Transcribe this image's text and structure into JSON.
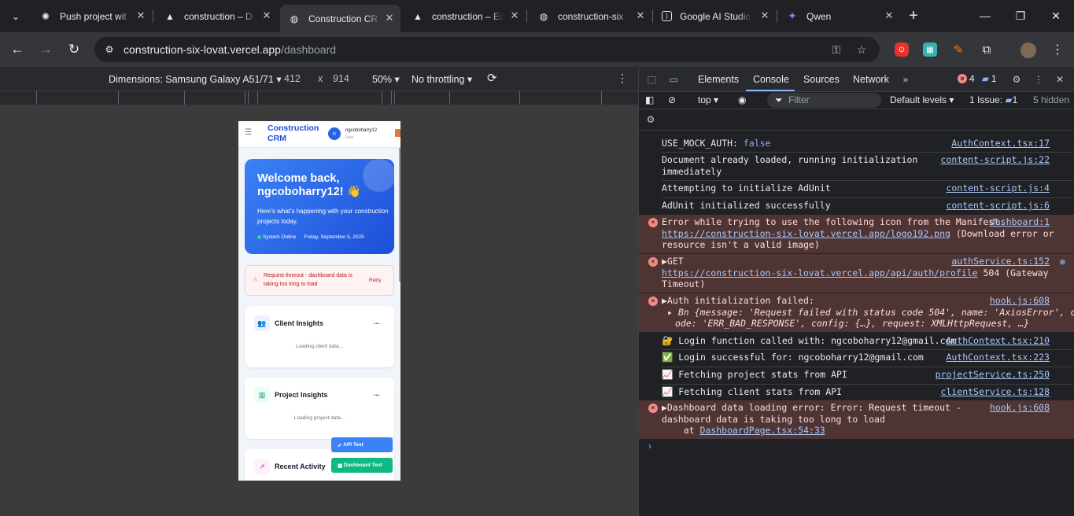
{
  "tabs": [
    {
      "title": "Push project wit",
      "icon": "openai-icon"
    },
    {
      "title": "construction – D",
      "icon": "vercel-icon"
    },
    {
      "title": "Construction CR",
      "icon": "globe-icon",
      "active": true
    },
    {
      "title": "construction – Ed",
      "icon": "vercel-icon"
    },
    {
      "title": "construction-six",
      "icon": "globe-icon"
    },
    {
      "title": "Google AI Studio",
      "icon": "ai-studio-icon"
    },
    {
      "title": "Qwen",
      "icon": "qwen-icon"
    }
  ],
  "address": {
    "host": "construction-six-lovat.vercel.app",
    "path": "/dashboard"
  },
  "device_toolbar": {
    "dimensions_label": "Dimensions: Samsung Galaxy A51/71",
    "width": "412",
    "times": "x",
    "height": "914",
    "zoom": "50%",
    "throttling": "No throttling"
  },
  "app": {
    "brand": "Construction CRM",
    "avatar_letter": "n",
    "user_name": "ngcoboharry12",
    "user_role": "User",
    "welcome_title": "Welcome back, ngcoboharry12! 👋",
    "welcome_text": "Here's what's happening with your construction projects today.",
    "status": "System Online",
    "date": "Friday, September 5, 2025",
    "alert_text": "Request timeout - dashboard data is taking too long to load",
    "retry": "Retry",
    "cards": [
      {
        "title": "Client Insights",
        "loading": "Loading client data..."
      },
      {
        "title": "Project Insights",
        "loading": "Loading project data..."
      },
      {
        "title": "Recent Activity",
        "loading": ""
      }
    ],
    "more": "...",
    "api_test": "API Test",
    "dashboard_test": "Dashboard Test"
  },
  "devtools": {
    "tabs": [
      "Elements",
      "Console",
      "Sources",
      "Network"
    ],
    "error_count": "4",
    "message_count": "1",
    "context": "top",
    "filter_placeholder": "Filter",
    "levels": "Default levels",
    "issues_label": "1 Issue:",
    "issues_count": "1",
    "hidden": "5 hidden"
  },
  "console": [
    {
      "type": "log",
      "text": "USE_MOCK_AUTH: ",
      "value": "false",
      "source": "AuthContext.tsx:17"
    },
    {
      "type": "log",
      "text": "Document already loaded, running initialization\nimmediately",
      "source": "content-script.js:22"
    },
    {
      "type": "log",
      "text": "Attempting to initialize AdUnit",
      "source": "content-script.js:4"
    },
    {
      "type": "log",
      "text": "AdUnit initialized successfully",
      "source": "content-script.js:6"
    },
    {
      "type": "error",
      "text": "Error while trying to use the following icon from the Manifest:",
      "link": "https://construction-six-lovat.vercel.app/logo192.png",
      "after": " (Download error or",
      "line3": "resource isn't a valid image)",
      "source": "dashboard:1"
    },
    {
      "type": "error",
      "text": "▶GET",
      "link": "https://construction-six-lovat.vercel.app/api/auth/profile",
      "after": " 504 (Gateway",
      "line3": "Timeout)",
      "source": "authService.ts:152"
    },
    {
      "type": "error",
      "text": "▶Auth initialization failed:",
      "line2": "▸ Bn {message: 'Request failed with status code 504', name: 'AxiosError', c",
      "line3": "ode: 'ERR_BAD_RESPONSE', config: {…}, request: XMLHttpRequest, …}",
      "source": "hook.js:608"
    },
    {
      "type": "log",
      "emoji": "🔐",
      "text": "Login function called with: ngcoboharry12@gmail.com",
      "source": "AuthContext.tsx:210"
    },
    {
      "type": "log",
      "emoji": "✅",
      "text": "Login successful for: ngcoboharry12@gmail.com",
      "source": "AuthContext.tsx:223"
    },
    {
      "type": "log",
      "emoji": "📈",
      "text": "Fetching project stats from API",
      "source": "projectService.ts:250"
    },
    {
      "type": "log",
      "emoji": "📈",
      "text": "Fetching client stats from API",
      "source": "clientService.ts:128"
    },
    {
      "type": "error",
      "text": "▶Dashboard data loading error: Error: Request timeout -",
      "line2": "dashboard data is taking too long to load",
      "line3_prefix": "    at ",
      "line3_link": "DashboardPage.tsx:54:33",
      "source": "hook.js:608"
    }
  ]
}
